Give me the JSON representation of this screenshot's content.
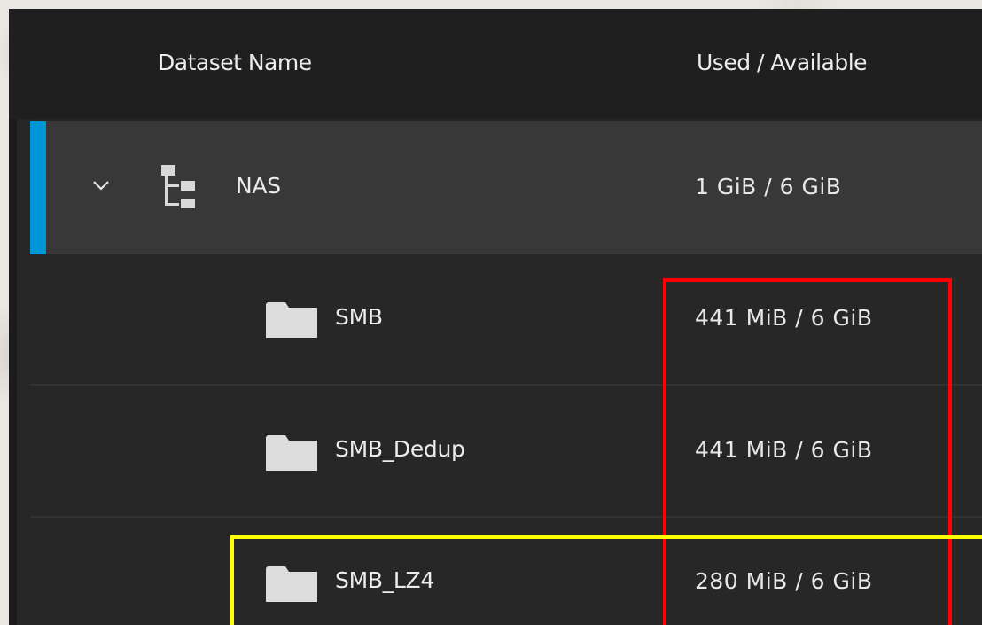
{
  "table": {
    "headers": {
      "name": "Dataset Name",
      "used": "Used / Available"
    },
    "rows": [
      {
        "name": "NAS",
        "usage": "1 GiB / 6 GiB",
        "type": "pool",
        "icon": "dataset-tree-icon",
        "expanded": true,
        "selected": true
      },
      {
        "name": "SMB",
        "usage": "441 MiB / 6 GiB",
        "type": "dataset",
        "icon": "folder-icon"
      },
      {
        "name": "SMB_Dedup",
        "usage": "441 MiB / 6 GiB",
        "type": "dataset",
        "icon": "folder-icon"
      },
      {
        "name": "SMB_LZ4",
        "usage": "280 MiB / 6 GiB",
        "type": "dataset",
        "icon": "folder-icon"
      }
    ]
  },
  "colors": {
    "accent": "#0095d5",
    "header_bg": "#1f1f1f",
    "selected_row_bg": "#383838",
    "row_bg": "#272727",
    "highlight_red": "#ff0000",
    "highlight_yellow": "#ffff00"
  },
  "icons": {
    "expand": "chevron-down-icon",
    "pool": "dataset-tree-icon",
    "dataset": "folder-icon"
  }
}
